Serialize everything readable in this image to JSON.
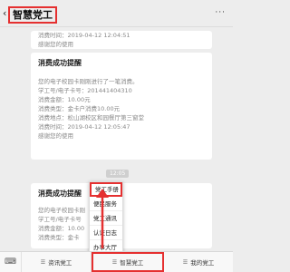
{
  "header": {
    "title": "智慧党工",
    "back_icon": "‹",
    "more_icon": "···"
  },
  "card1": {
    "lines": [
      "消费时间：2019-04-12 12:04:51",
      "感谢您的使用"
    ]
  },
  "card2": {
    "title": "消费成功提醒",
    "lines": [
      "您的电子校园卡刚刚进行了一笔消费。",
      "学工号/电子卡号：201441404310",
      "消费金额：10.00元",
      "消费类型：金卡户消费10.00元",
      "消费地点：松山湖校区和园餐厅第三窗堂",
      "消费时间：2019-04-12 12:05:47",
      "感谢您的使用"
    ]
  },
  "time_sep": "12:05",
  "card3": {
    "title": "消费成功提醒",
    "lines": [
      "您的电子校园卡刚",
      "学工号/电子卡号",
      "消费金额：10.00",
      "消费类型：金卡",
      "消费地点：松山湖校区和园餐厅第二窗堂",
      "消费时间：2019-",
      "感谢您的使用"
    ]
  },
  "popup": {
    "items": [
      "党工手册",
      "便民服务",
      "党工通讯",
      "认证日志",
      "办事大厅"
    ]
  },
  "bottom": {
    "keyboard_icon": "⌨",
    "tabs": [
      "资讯党工",
      "智慧党工",
      "我的党工"
    ]
  },
  "colors": {
    "highlight": "#e53030"
  }
}
